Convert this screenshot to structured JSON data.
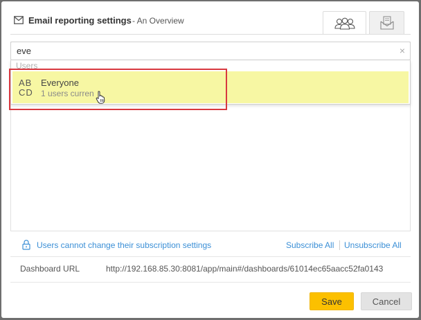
{
  "dialog": {
    "title": "Email reporting settings",
    "subtitle": "- An Overview",
    "icons": {
      "title_icon": "mail-icon",
      "tab_users_icon": "users-group-icon",
      "tab_report_icon": "report-mail-icon"
    }
  },
  "search": {
    "value": "eve",
    "clear_glyph": "×"
  },
  "dropdown": {
    "group_label": "Users",
    "option": {
      "avatar_line1": "AB",
      "avatar_line2": "CD",
      "name": "Everyone",
      "subtext": "1 users curren"
    }
  },
  "settings": {
    "notice": "Users cannot change their subscription settings",
    "subscribe_all": "Subscribe All",
    "unsubscribe_all": "Unsubscribe All"
  },
  "url": {
    "label": "Dashboard URL",
    "value": "http://192.168.85.30:8081/app/main#/dashboards/61014ec65aacc52fa0143"
  },
  "buttons": {
    "save": "Save",
    "cancel": "Cancel"
  },
  "colors": {
    "accent_yellow": "#fcc000",
    "link_blue": "#3b8fd6",
    "highlight_row": "#f7f7a3",
    "annotation_red": "#d8383f"
  }
}
